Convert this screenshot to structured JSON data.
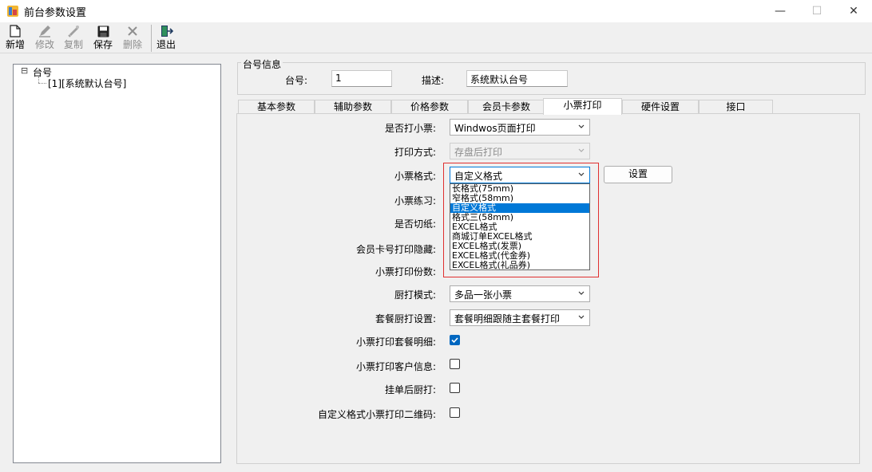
{
  "window": {
    "title": "前台参数设置",
    "controls": [
      "—",
      "☐",
      "✕"
    ]
  },
  "toolbar": {
    "buttons": [
      {
        "label": "新增",
        "icon": "new-file-icon",
        "enabled": true
      },
      {
        "label": "修改",
        "icon": "edit-icon",
        "enabled": false
      },
      {
        "label": "复制",
        "icon": "copy-icon",
        "enabled": false
      },
      {
        "label": "保存",
        "icon": "save-icon",
        "enabled": true
      },
      {
        "label": "删除",
        "icon": "delete-icon",
        "enabled": false
      },
      {
        "label": "退出",
        "icon": "exit-icon",
        "enabled": true
      }
    ]
  },
  "tree": {
    "root": {
      "toggle": "⊟",
      "label": "台号"
    },
    "child": {
      "label": "[1][系统默认台号]"
    }
  },
  "station_info": {
    "group_title": "台号信息",
    "number_label": "台号:",
    "number_value": "1",
    "desc_label": "描述:",
    "desc_value": "系统默认台号"
  },
  "tabs": [
    {
      "label": "基本参数",
      "active": false
    },
    {
      "label": "辅助参数",
      "active": false
    },
    {
      "label": "价格参数",
      "active": false
    },
    {
      "label": "会员卡参数",
      "active": false
    },
    {
      "label": "小票打印",
      "active": true
    },
    {
      "label": "硬件设置",
      "active": false
    },
    {
      "label": "接口",
      "active": false
    }
  ],
  "form": {
    "print_receipt": {
      "label": "是否打小票:",
      "value": "Windwos页面打印"
    },
    "print_mode": {
      "label": "打印方式:",
      "value": "存盘后打印"
    },
    "receipt_format": {
      "label": "小票格式:",
      "value": "自定义格式",
      "button": "设置"
    },
    "receipt_practice": {
      "label": "小票练习:"
    },
    "cut_paper": {
      "label": "是否切纸:"
    },
    "hide_card": {
      "label": "会员卡号打印隐藏:"
    },
    "copies": {
      "label": "小票打印份数:"
    },
    "kitchen_mode": {
      "label": "厨打模式:",
      "value": "多品一张小票"
    },
    "set_kitchen": {
      "label": "套餐厨打设置:",
      "value": "套餐明细跟随主套餐打印"
    },
    "print_set_detail": {
      "label": "小票打印套餐明细:",
      "checked": true
    },
    "print_customer": {
      "label": "小票打印客户信息:",
      "checked": false
    },
    "kitchen_after_hold": {
      "label": "挂单后厨打:",
      "checked": false
    },
    "custom_qr": {
      "label": "自定义格式小票打印二维码:",
      "checked": false
    }
  },
  "dropdown": {
    "items": [
      "长格式(75mm)",
      "窄格式(58mm)",
      "自定义格式",
      "格式三(58mm)",
      "EXCEL格式",
      "商城订单EXCEL格式",
      "EXCEL格式(发票)",
      "EXCEL格式(代金券)",
      "EXCEL格式(礼品券)"
    ],
    "selected_index": 2
  },
  "colors": {
    "accent": "#0078d7",
    "checkbox": "#0067c0",
    "highlight_box": "#e03030"
  }
}
